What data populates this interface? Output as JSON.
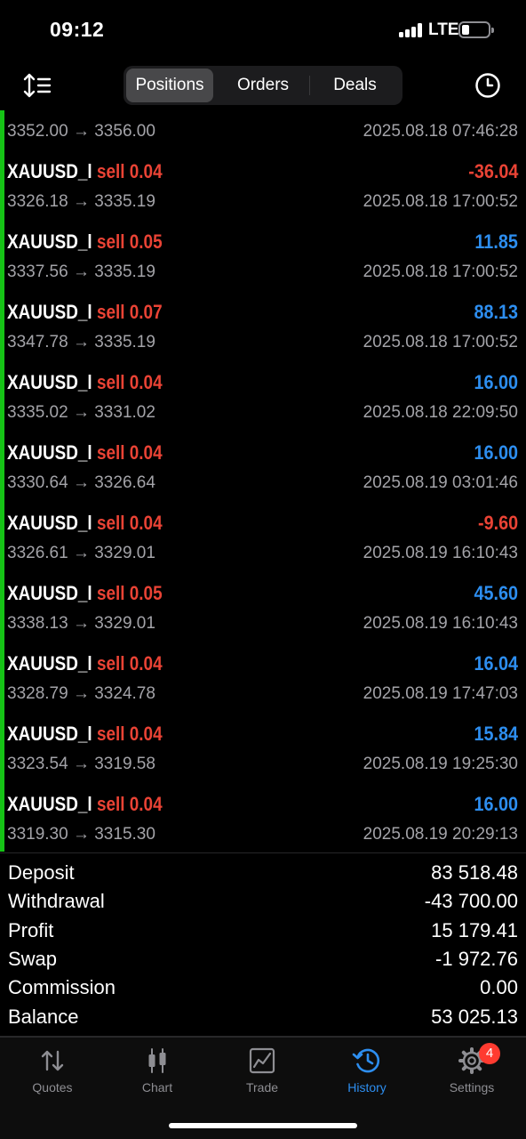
{
  "status_bar": {
    "time": "09:12",
    "network": "LTE"
  },
  "nav": {
    "tabs": [
      "Positions",
      "Orders",
      "Deals"
    ],
    "active_tab": "Positions"
  },
  "partial_row": {
    "prices": "3352.00 → 3356.00",
    "date": "2025.08.18 07:46:28"
  },
  "deals": [
    {
      "symbol": "XAUUSD_l",
      "side": "sell",
      "volume": "0.04",
      "profit": "-36.04",
      "prices": "3326.18 → 3335.19",
      "date": "2025.08.18 17:00:52"
    },
    {
      "symbol": "XAUUSD_l",
      "side": "sell",
      "volume": "0.05",
      "profit": "11.85",
      "prices": "3337.56 → 3335.19",
      "date": "2025.08.18 17:00:52"
    },
    {
      "symbol": "XAUUSD_l",
      "side": "sell",
      "volume": "0.07",
      "profit": "88.13",
      "prices": "3347.78 → 3335.19",
      "date": "2025.08.18 17:00:52"
    },
    {
      "symbol": "XAUUSD_l",
      "side": "sell",
      "volume": "0.04",
      "profit": "16.00",
      "prices": "3335.02 → 3331.02",
      "date": "2025.08.18 22:09:50"
    },
    {
      "symbol": "XAUUSD_l",
      "side": "sell",
      "volume": "0.04",
      "profit": "16.00",
      "prices": "3330.64 → 3326.64",
      "date": "2025.08.19 03:01:46"
    },
    {
      "symbol": "XAUUSD_l",
      "side": "sell",
      "volume": "0.04",
      "profit": "-9.60",
      "prices": "3326.61 → 3329.01",
      "date": "2025.08.19 16:10:43"
    },
    {
      "symbol": "XAUUSD_l",
      "side": "sell",
      "volume": "0.05",
      "profit": "45.60",
      "prices": "3338.13 → 3329.01",
      "date": "2025.08.19 16:10:43"
    },
    {
      "symbol": "XAUUSD_l",
      "side": "sell",
      "volume": "0.04",
      "profit": "16.04",
      "prices": "3328.79 → 3324.78",
      "date": "2025.08.19 17:47:03"
    },
    {
      "symbol": "XAUUSD_l",
      "side": "sell",
      "volume": "0.04",
      "profit": "15.84",
      "prices": "3323.54 → 3319.58",
      "date": "2025.08.19 19:25:30"
    },
    {
      "symbol": "XAUUSD_l",
      "side": "sell",
      "volume": "0.04",
      "profit": "16.00",
      "prices": "3319.30 → 3315.30",
      "date": "2025.08.19 20:29:13"
    }
  ],
  "summary": [
    {
      "label": "Deposit",
      "value": "83 518.48"
    },
    {
      "label": "Withdrawal",
      "value": "-43 700.00"
    },
    {
      "label": "Profit",
      "value": "15 179.41"
    },
    {
      "label": "Swap",
      "value": "-1 972.76"
    },
    {
      "label": "Commission",
      "value": "0.00"
    },
    {
      "label": "Balance",
      "value": "53 025.13"
    }
  ],
  "tabbar": {
    "items": [
      {
        "label": "Quotes",
        "icon": "quotes-arrows-icon"
      },
      {
        "label": "Chart",
        "icon": "candlestick-icon"
      },
      {
        "label": "Trade",
        "icon": "trade-chart-icon"
      },
      {
        "label": "History",
        "icon": "history-clock-icon"
      },
      {
        "label": "Settings",
        "icon": "gear-icon"
      }
    ],
    "active": "History",
    "settings_badge": "4"
  },
  "colors": {
    "profit_positive": "#2d8ef0",
    "profit_negative": "#ea4335",
    "sell": "#ea4335",
    "accent": "#2d8ef0",
    "position_bar": "#16c316"
  }
}
